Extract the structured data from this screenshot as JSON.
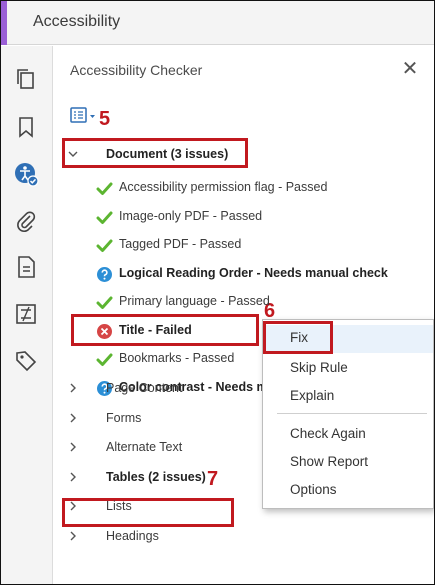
{
  "window": {
    "title": "Accessibility"
  },
  "panel": {
    "title": "Accessibility Checker",
    "close_glyph": "✕"
  },
  "tree": {
    "document": {
      "label": "Document (3 issues)"
    },
    "checks": [
      {
        "label": "Accessibility permission flag - Passed",
        "status": "passed"
      },
      {
        "label": "Image-only PDF - Passed",
        "status": "passed"
      },
      {
        "label": "Tagged PDF - Passed",
        "status": "passed"
      },
      {
        "label": "Logical Reading Order - Needs manual check",
        "status": "manual"
      },
      {
        "label": "Primary language - Passed",
        "status": "passed"
      },
      {
        "label": "Title - Failed",
        "status": "failed"
      },
      {
        "label": "Bookmarks - Passed",
        "status": "passed"
      },
      {
        "label": "Color contrast - Needs m",
        "status": "manual"
      }
    ],
    "categories": [
      {
        "label": "Page Content"
      },
      {
        "label": "Forms"
      },
      {
        "label": "Alternate Text"
      },
      {
        "label": "Tables (2 issues)"
      },
      {
        "label": "Lists"
      },
      {
        "label": "Headings"
      }
    ]
  },
  "context_menu": {
    "items": [
      {
        "label": "Fix",
        "highlighted": true
      },
      {
        "label": "Skip Rule"
      },
      {
        "label": "Explain"
      },
      {
        "label": "Check Again"
      },
      {
        "label": "Show Report"
      },
      {
        "label": "Options"
      }
    ]
  },
  "callouts": {
    "step5": "5",
    "step6": "6",
    "step7": "7"
  },
  "colors": {
    "accent": "#9a5fd6",
    "pass": "#5cb531",
    "fail": "#d64545",
    "info": "#2c8fd6",
    "callout": "#c1191f",
    "menu_highlight": "#e9f2fb"
  }
}
